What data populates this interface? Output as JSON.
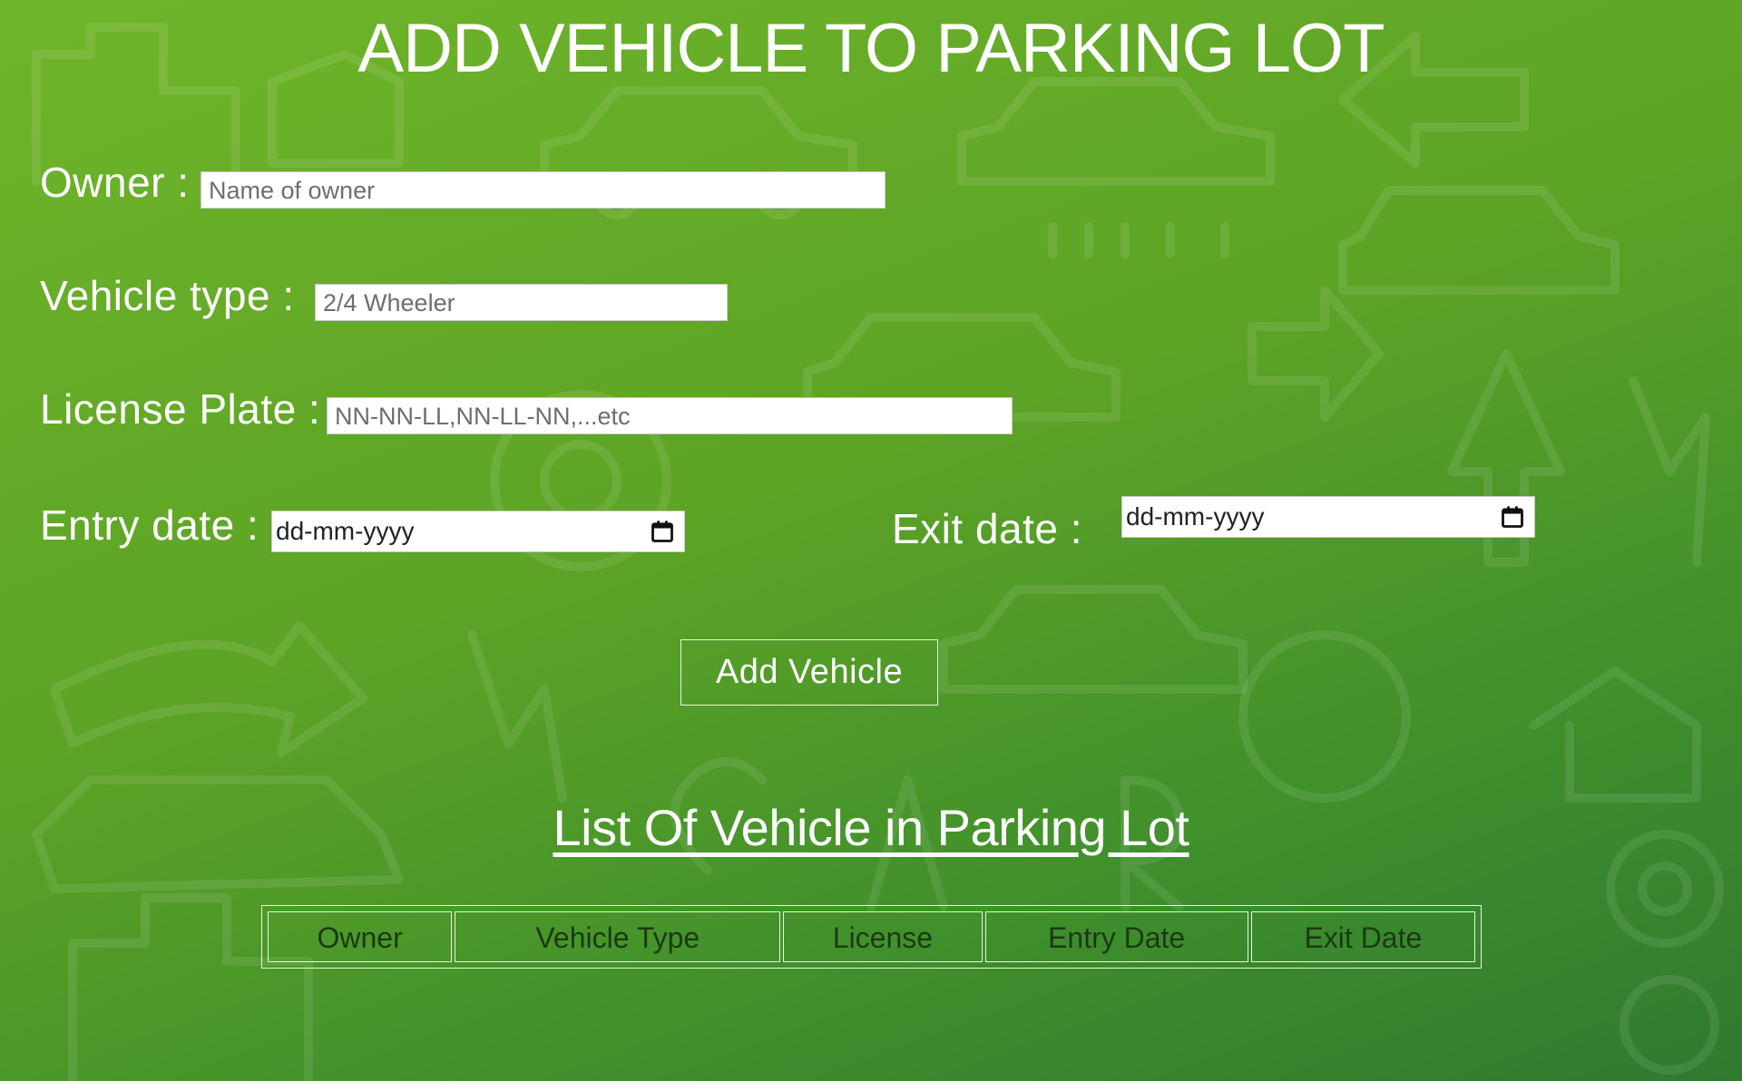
{
  "page": {
    "title": "ADD VEHICLE TO PARKING LOT"
  },
  "form": {
    "owner": {
      "label": "Owner :",
      "placeholder": "Name of owner",
      "value": ""
    },
    "vehicle_type": {
      "label": "Vehicle type :",
      "placeholder": "2/4 Wheeler",
      "value": ""
    },
    "license_plate": {
      "label": "License Plate :",
      "placeholder": "NN-NN-LL,NN-LL-NN,...etc",
      "value": ""
    },
    "entry_date": {
      "label": "Entry date :",
      "placeholder": "dd-mm-yyyy",
      "icon": "calendar-icon"
    },
    "exit_date": {
      "label": "Exit date :",
      "placeholder": "dd-mm-yyyy",
      "icon": "calendar-icon"
    },
    "submit_label": "Add Vehicle"
  },
  "list": {
    "title": "List Of Vehicle in Parking Lot",
    "columns": [
      "Owner",
      "Vehicle Type",
      "License",
      "Entry Date",
      "Exit Date"
    ],
    "rows": []
  },
  "colors": {
    "background_start": "#6fb52a",
    "background_end": "#2f7a30",
    "text": "#ffffff",
    "table_header_text": "#1b3a12"
  }
}
